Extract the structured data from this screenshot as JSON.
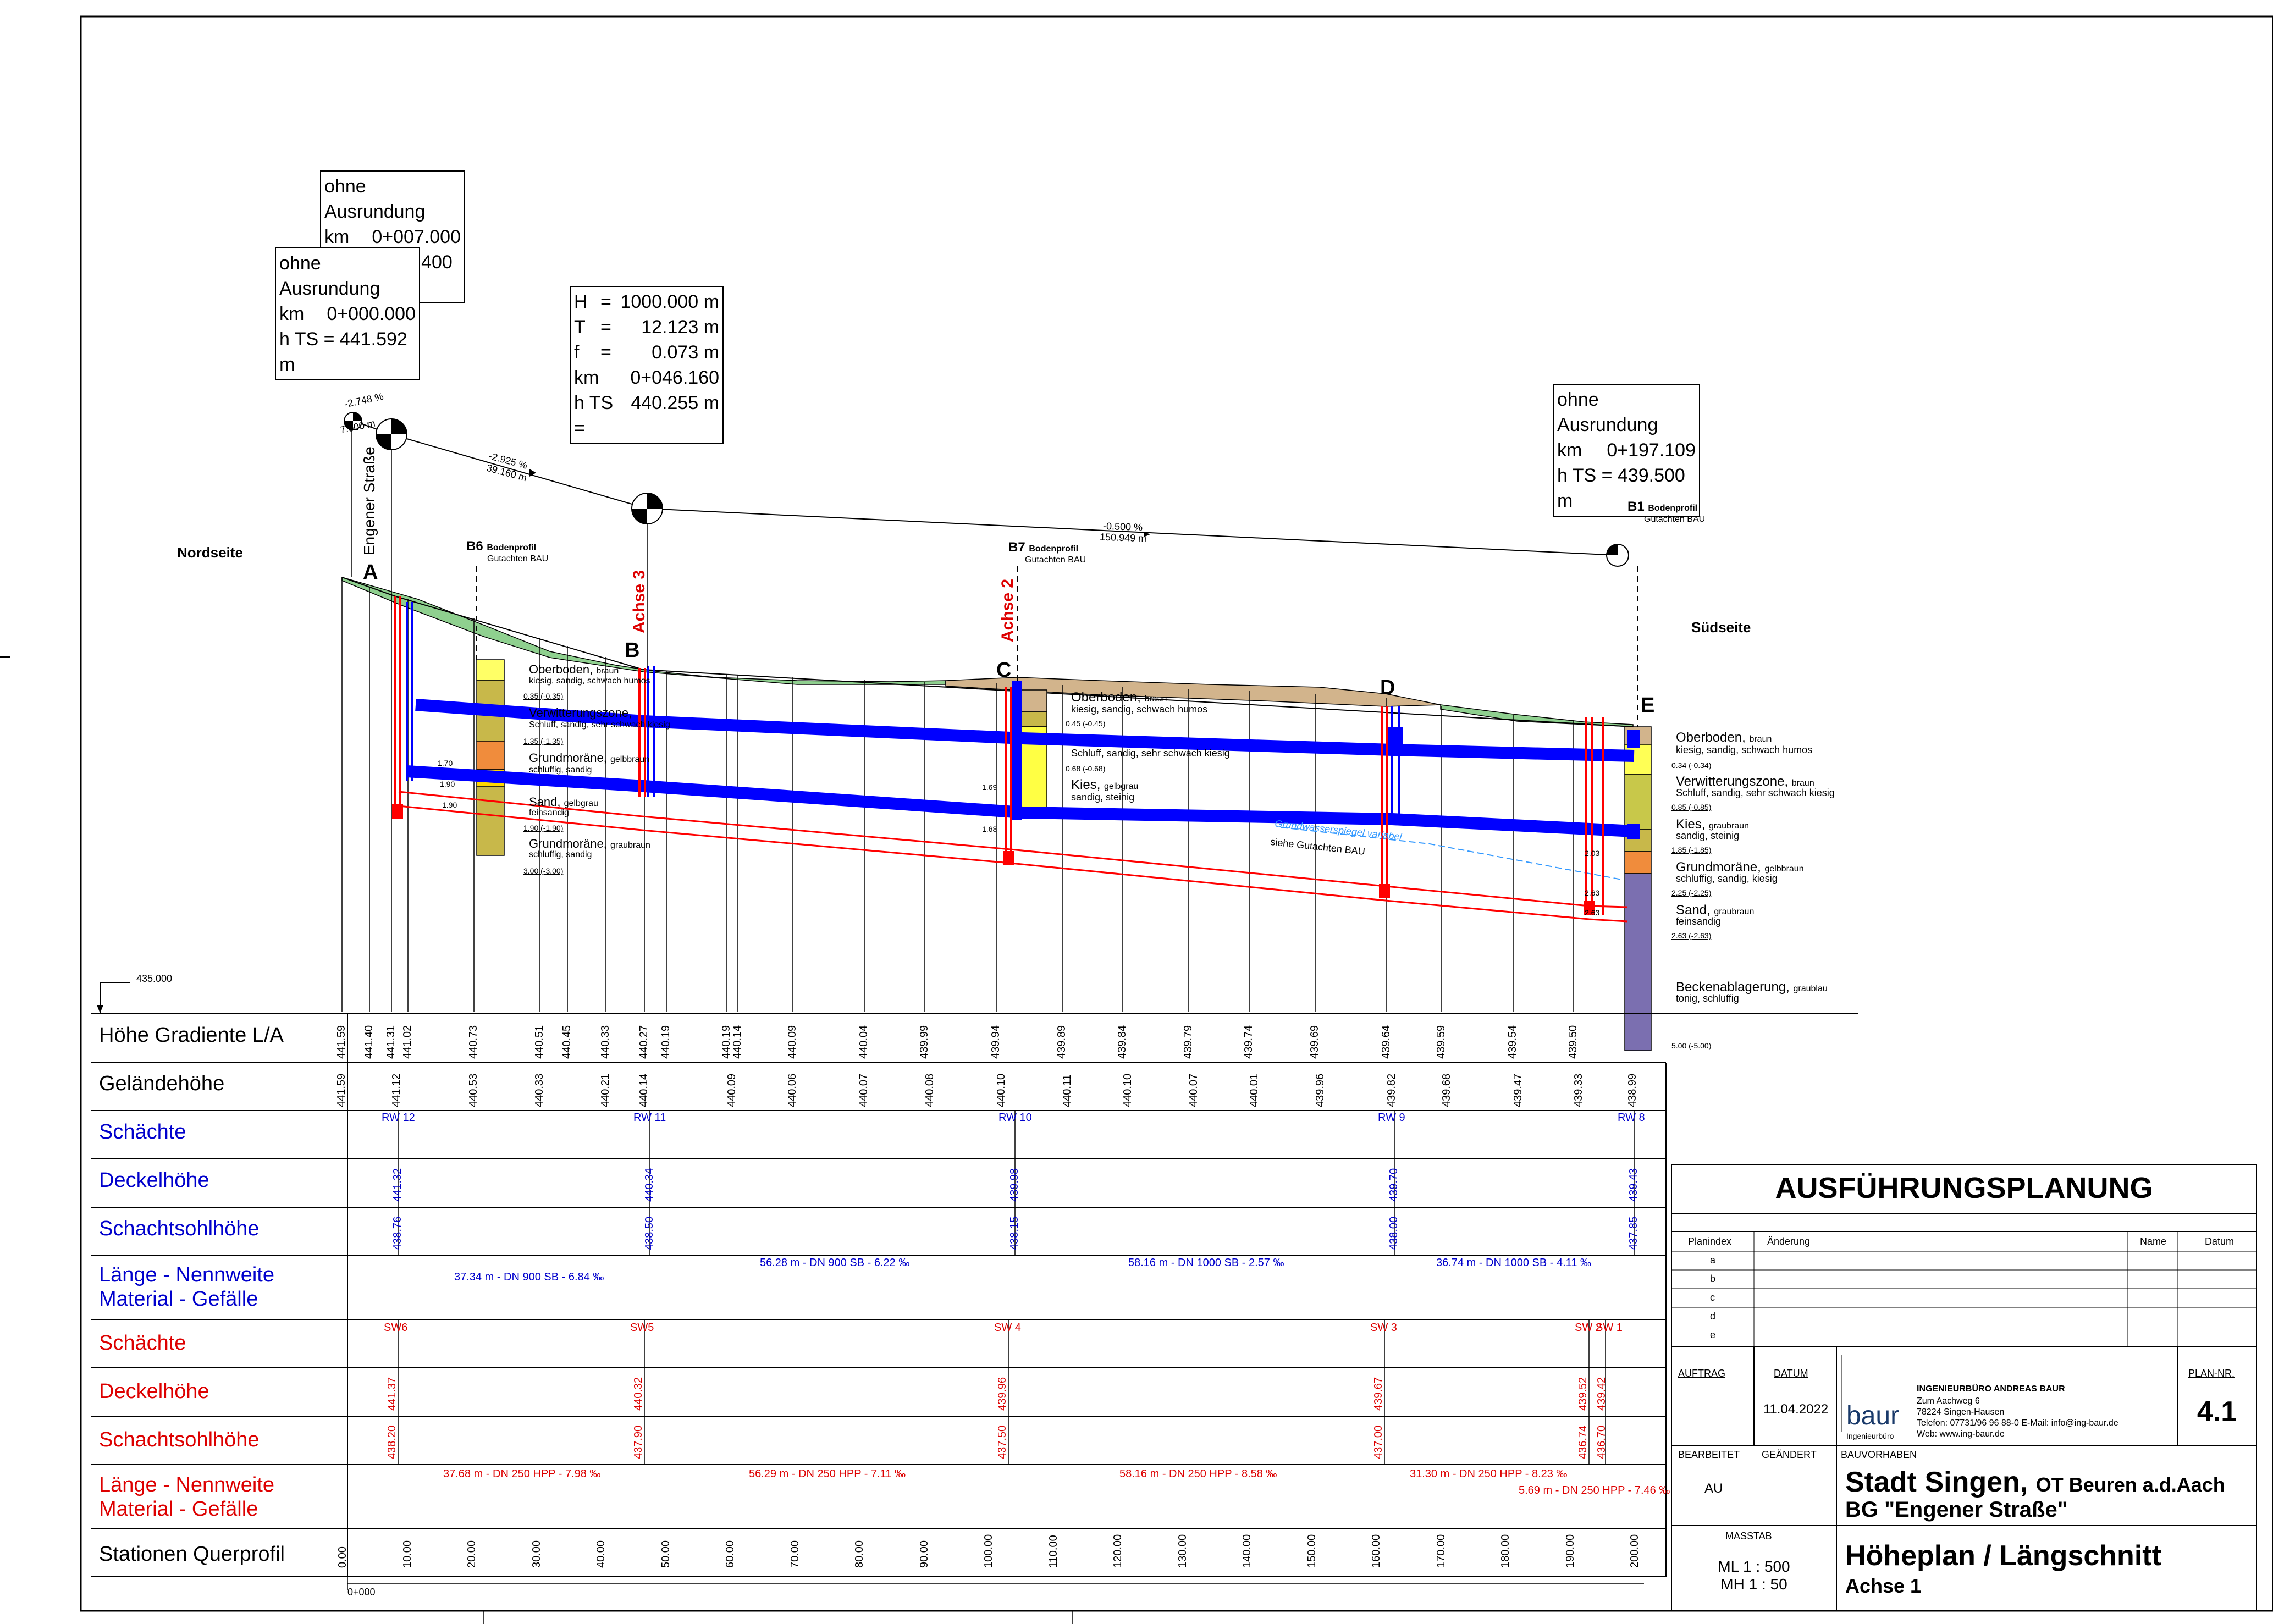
{
  "side_labels": {
    "north": "Nordseite",
    "south": "Südseite",
    "street": "Engener Straße"
  },
  "axes": {
    "achse3": "Achse 3",
    "achse2": "Achse 2"
  },
  "points": [
    "A",
    "B",
    "C",
    "D",
    "E"
  ],
  "datum_level": "435.000",
  "start_station": "0+000",
  "info_boxes": {
    "box1": {
      "title": "ohne Ausrundung",
      "km_label": "km",
      "km": "0+007.000",
      "hts_label": "h TS = 441.400 m"
    },
    "box2": {
      "title": "ohne Ausrundung",
      "km_label": "km",
      "km": "0+000.000",
      "hts_label": "h TS = 441.592 m"
    },
    "box3": {
      "H": "1000.000 m",
      "T": "12.123 m",
      "f": "0.073 m",
      "km": "0+046.160",
      "hTS": "440.255 m"
    },
    "box4": {
      "title": "ohne Ausrundung",
      "km_label": "km",
      "km": "0+197.109",
      "hts_label": "h TS = 439.500 m"
    }
  },
  "gradients": [
    {
      "pct": "-2.748 %",
      "len": "7.000 m"
    },
    {
      "pct": "-2.925 %",
      "len": "39.160 m"
    },
    {
      "pct": "-0.500 %",
      "len": "150.949 m"
    }
  ],
  "boreholes": {
    "B6": {
      "name": "B6",
      "l1": "Bodenprofil",
      "l2": "Gutachten BAU"
    },
    "B7": {
      "name": "B7",
      "l1": "Bodenprofil",
      "l2": "Gutachten BAU"
    },
    "B1": {
      "name": "B1",
      "l1": "Bodenprofil",
      "l2": "Gutachten BAU"
    }
  },
  "soil_b6": [
    {
      "name": "Oberboden,",
      "desc": "kiesig, sandig, schwach humos",
      "depth": "0.35 (-0.35)"
    },
    {
      "name": "Verwitterungszone,",
      "desc": "Schluff, sandig, sehr schwach kiesig",
      "depth": "1.35 (-1.35)"
    },
    {
      "name": "Grundmoräne,",
      "desc": "schluffig, sandig",
      "depth": ""
    },
    {
      "name": "Sand,",
      "desc": "feinsandig",
      "depth": "1.90 (-1.90)"
    },
    {
      "name": "Grundmoräne,",
      "desc": "schluffig, sandig",
      "depth": "3.00 (-3.00)"
    }
  ],
  "soil_b6_extra": {
    "gelbbraun": "gelbbraun",
    "graubraun": "graubraun",
    "gelbgrau": "gelbgrau",
    "braun": "braun",
    "d170": "1.70",
    "d190": "1.90",
    "d190b": "1.90"
  },
  "soil_b7": [
    {
      "name": "Oberboden,",
      "extra": "braun",
      "desc": "kiesig, sandig, schwach humos",
      "depth": "0.45 (-0.45)"
    },
    {
      "name": "",
      "extra": "",
      "desc": "Schluff, sandig, sehr schwach kiesig",
      "depth": "0.68 (-0.68)"
    },
    {
      "name": "Kies,",
      "extra": "gelbgrau",
      "desc": "sandig, steinig",
      "depth": ""
    }
  ],
  "b7_marks": {
    "m1": "1.69",
    "m2": "1.68"
  },
  "soil_b1": [
    {
      "name": "Oberboden,",
      "extra": "braun",
      "desc": "kiesig, sandig, schwach humos",
      "depth": "0.34 (-0.34)"
    },
    {
      "name": "Verwitterungszone,",
      "extra": "braun",
      "desc": "Schluff, sandig, sehr schwach kiesig",
      "depth": "0.85 (-0.85)"
    },
    {
      "name": "Kies,",
      "extra": "graubraun",
      "desc": "sandig, steinig",
      "depth": "1.85 (-1.85)"
    },
    {
      "name": "Grundmoräne,",
      "extra": "gelbbraun",
      "desc": "schluffig, sandig, kiesig",
      "depth": "2.25 (-2.25)"
    },
    {
      "name": "Sand,",
      "extra": "graubraun",
      "desc": "feinsandig",
      "depth": "2.63 (-2.63)"
    },
    {
      "name": "Beckenablagerung,",
      "extra": "graublau",
      "desc": "tonig, schluffig",
      "depth": "5.00 (-5.00)"
    }
  ],
  "b1_marks": {
    "m1": "2.03",
    "m2": "2.63",
    "m3": "2.63"
  },
  "groundwater": {
    "l1": "Grundwasserspiegel variabel",
    "l2": "siehe Gutachten BAU"
  },
  "row_labels": {
    "gradiente": "Höhe Gradiente L/A",
    "gelaende": "Geländehöhe",
    "schaechte_rw": "Schächte",
    "deckel_rw": "Deckelhöhe",
    "sohle_rw": "Schachtsohlhöhe",
    "laenge_rw_1": "Länge - Nennweite",
    "laenge_rw_2": "Material - Gefälle",
    "schaechte_sw": "Schächte",
    "deckel_sw": "Deckelhöhe",
    "sohle_sw": "Schachtsohlhöhe",
    "laenge_sw_1": "Länge - Nennweite",
    "laenge_sw_2": "Material - Gefälle",
    "stationen": "Stationen Querprofil"
  },
  "gradiente_values": [
    "441.59",
    "441.40",
    "441.31",
    "441.02",
    "440.73",
    "440.51",
    "440.45",
    "440.33",
    "440.27",
    "440.19",
    "440.19",
    "440.14",
    "440.09",
    "440.04",
    "439.99",
    "439.94",
    "439.89",
    "439.84",
    "439.79",
    "439.74",
    "439.69",
    "439.64",
    "439.59",
    "439.54",
    "439.50"
  ],
  "gelaende_values": [
    "441.59",
    "441.12",
    "440.53",
    "440.33",
    "440.21",
    "440.14",
    "440.09",
    "440.06",
    "440.07",
    "440.08",
    "440.10",
    "440.11",
    "440.10",
    "440.07",
    "440.01",
    "439.96",
    "439.82",
    "439.68",
    "439.47",
    "439.33",
    "438.99"
  ],
  "rw_shafts": [
    "RW 12",
    "RW 11",
    "RW 10",
    "RW 9",
    "RW 8"
  ],
  "rw_deckel": [
    "441.32",
    "440.34",
    "439.98",
    "439.70",
    "439.43"
  ],
  "rw_sohle": [
    "438.76",
    "438.50",
    "438.15",
    "438.00",
    "437.85"
  ],
  "rw_pipes": [
    "37.34 m - DN 900 SB - 6.84 ‰",
    "56.28 m - DN 900 SB - 6.22 ‰",
    "58.16 m - DN 1000 SB - 2.57 ‰",
    "36.74 m - DN 1000 SB - 4.11 ‰"
  ],
  "sw_shafts": [
    "SW6",
    "SW5",
    "SW 4",
    "SW 3",
    "SW 2",
    "SW 1"
  ],
  "sw_deckel": [
    "441.37",
    "440.32",
    "439.96",
    "439.67",
    "439.52",
    "439.42"
  ],
  "sw_sohle": [
    "438.20",
    "437.90",
    "437.50",
    "437.00",
    "436.74",
    "436.70"
  ],
  "sw_pipes": [
    "37.68 m - DN 250 HPP - 7.98 ‰",
    "56.29 m - DN 250 HPP - 7.11 ‰",
    "58.16 m - DN 250 HPP - 8.58 ‰",
    "31.30 m - DN 250 HPP - 8.23 ‰",
    "5.69 m - DN 250 HPP - 7.46 ‰"
  ],
  "stations": [
    "0.00",
    "10.00",
    "20.00",
    "30.00",
    "40.00",
    "50.00",
    "60.00",
    "70.00",
    "80.00",
    "90.00",
    "100.00",
    "110.00",
    "120.00",
    "130.00",
    "140.00",
    "150.00",
    "160.00",
    "170.00",
    "180.00",
    "190.00",
    "200.00"
  ],
  "title_block": {
    "heading": "AUSFÜHRUNGSPLANUNG",
    "col_planindex": "Planindex",
    "col_aenderung": "Änderung",
    "col_name": "Name",
    "col_datum": "Datum",
    "indices": [
      "a",
      "b",
      "c",
      "d",
      "e"
    ],
    "auftrag": "AUFTRAG",
    "datum_label": "DATUM",
    "datum": "11.04.2022",
    "firm_name": "INGENIEURBÜRO ANDREAS BAUR",
    "firm_street": "Zum Aachweg 6",
    "firm_city": "78224 Singen-Hausen",
    "firm_phone": "Telefon: 07731/96 96 88-0 E-Mail: info@ing-baur.de",
    "firm_web": "Web: www.ing-baur.de",
    "logo": "baur",
    "logo_sub": "Ingenieurbüro",
    "plan_nr_label": "PLAN-NR.",
    "plan_nr": "4.1",
    "bearbeitet": "BEARBEITET",
    "geaendert": "GEÄNDERT",
    "bauvorhaben": "BAUVORHABEN",
    "bearbeiter": "AU",
    "project_city": "Stadt Singen,",
    "project_sub": "OT Beuren a.d.Aach",
    "project_name": "BG \"Engener Straße\"",
    "massstab": "MASSTAB",
    "ml": "ML 1 : 500",
    "mh": "MH 1 : 50",
    "plan_title": "Höheplan / Längschnitt",
    "plan_axis": "Achse 1"
  },
  "colors": {
    "rain": "#0000ff",
    "sewer": "#ff0000",
    "terrain_green": "#8fd08f",
    "terrain_brown": "#d2b48c",
    "label_blue": "#0000cc",
    "label_red": "#dd0000",
    "groundwater": "#3399ff"
  }
}
